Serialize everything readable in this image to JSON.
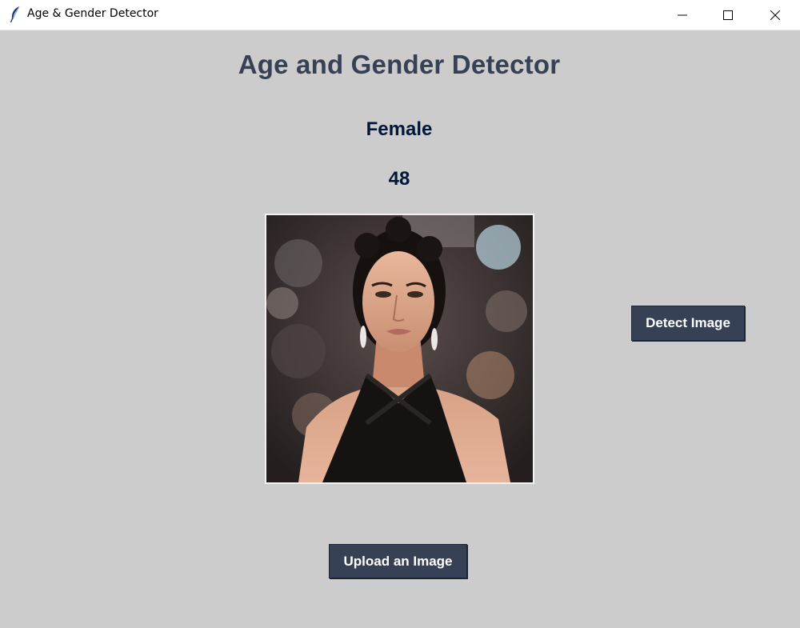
{
  "window": {
    "title": "Age & Gender Detector",
    "app_icon": "feather-icon",
    "controls": [
      "minimize-icon",
      "maximize-icon",
      "close-icon"
    ]
  },
  "main": {
    "heading": "Age and Gender Detector",
    "result": {
      "gender": "Female",
      "age": "48"
    },
    "buttons": {
      "detect_label": "Detect Image",
      "upload_label": "Upload an Image"
    }
  },
  "colors": {
    "background": "#cccccc",
    "heading": "#364156",
    "result_text": "#011638",
    "button_bg": "#364156",
    "button_text": "#ffffff"
  }
}
